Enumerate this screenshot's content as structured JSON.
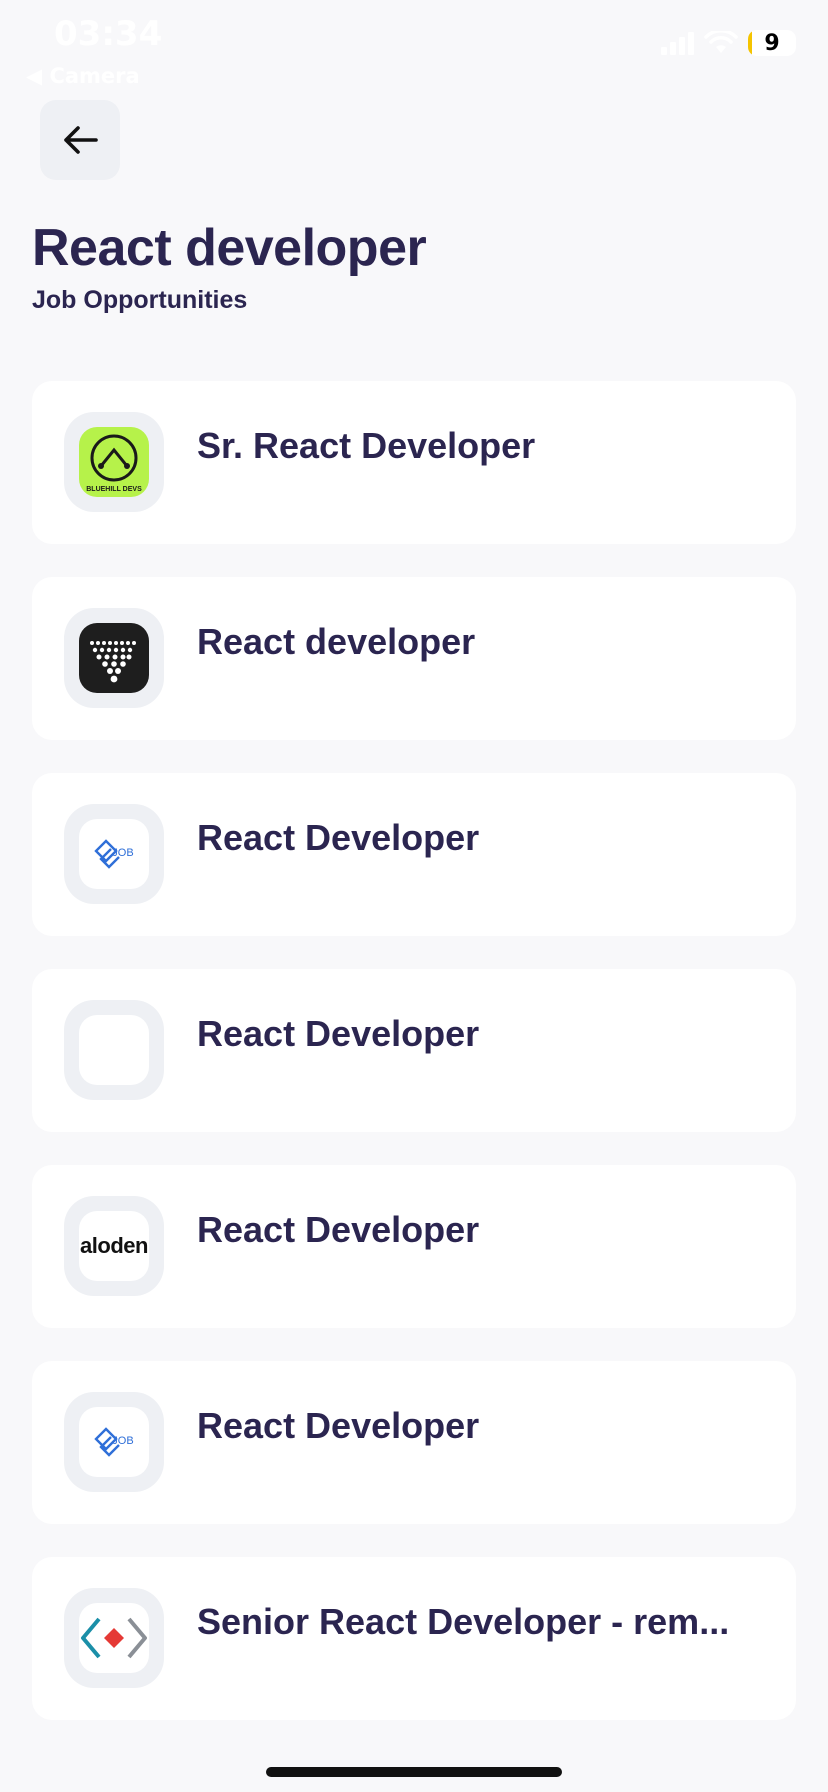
{
  "status_bar": {
    "time": "03:34",
    "back_app": "◀ Camera",
    "battery": "9",
    "colors": {
      "battery_fill": "#f5c400"
    }
  },
  "header": {
    "back_icon": "arrow-left-icon",
    "title": "React developer",
    "subtitle": "Job Opportunities"
  },
  "jobs": [
    {
      "title": "Sr. React Developer",
      "logo": "bluehill-devs-logo",
      "logo_text": "BLUEHILL DEVS"
    },
    {
      "title": "React developer",
      "logo": "dark-dots-logo"
    },
    {
      "title": "React Developer",
      "logo": "job-diamond-logo",
      "logo_text": "JOB"
    },
    {
      "title": "React Developer",
      "logo": "blank-logo"
    },
    {
      "title": "React Developer",
      "logo": "aloden-logo",
      "logo_text": "aloden"
    },
    {
      "title": "React Developer",
      "logo": "job-diamond-logo",
      "logo_text": "JOB"
    },
    {
      "title": "Senior React Developer - rem...",
      "logo": "code-brackets-logo"
    }
  ],
  "colors": {
    "background": "#f8f8fa",
    "card": "#ffffff",
    "text": "#2b2550",
    "logo_box": "#eef0f4",
    "bluehill_green": "#b6f24a",
    "job_blue": "#2f6fd8"
  }
}
